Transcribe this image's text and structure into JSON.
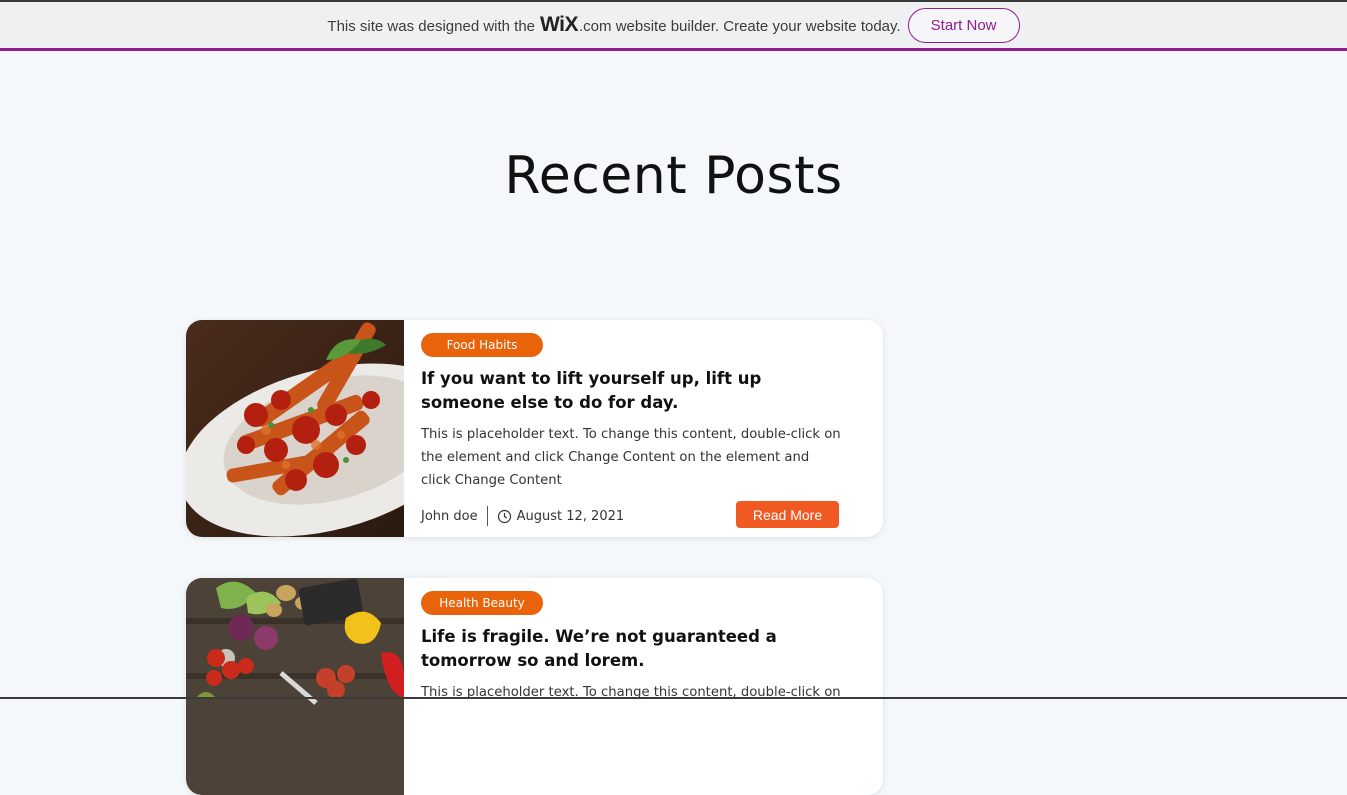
{
  "wix_banner": {
    "text_before": "This site was designed with the",
    "logo": "WiX",
    "text_after": ".com website builder. Create your website today.",
    "button_label": "Start Now",
    "accent_color": "#8e1d8f"
  },
  "page": {
    "title": "Recent Posts"
  },
  "posts": [
    {
      "category": "Food Habits",
      "title": "If you want to lift yourself up, lift up someone else to do for day.",
      "excerpt": "This is placeholder text. To change this content, double-click on the element and click Change Content on the element and click Change Content",
      "author": "John doe",
      "date": "August 12, 2021",
      "read_more": "Read More",
      "image": "pasta-dish-photo"
    },
    {
      "category": "Health Beauty",
      "title": "Life is fragile. We’re not guaranteed a tomorrow so and lorem.",
      "excerpt": "This is placeholder text. To change this content, double-click on",
      "image": "vegetables-photo"
    }
  ],
  "colors": {
    "tag": "#e8630a",
    "read_more": "#f05a22",
    "background": "#f4f8fb"
  }
}
